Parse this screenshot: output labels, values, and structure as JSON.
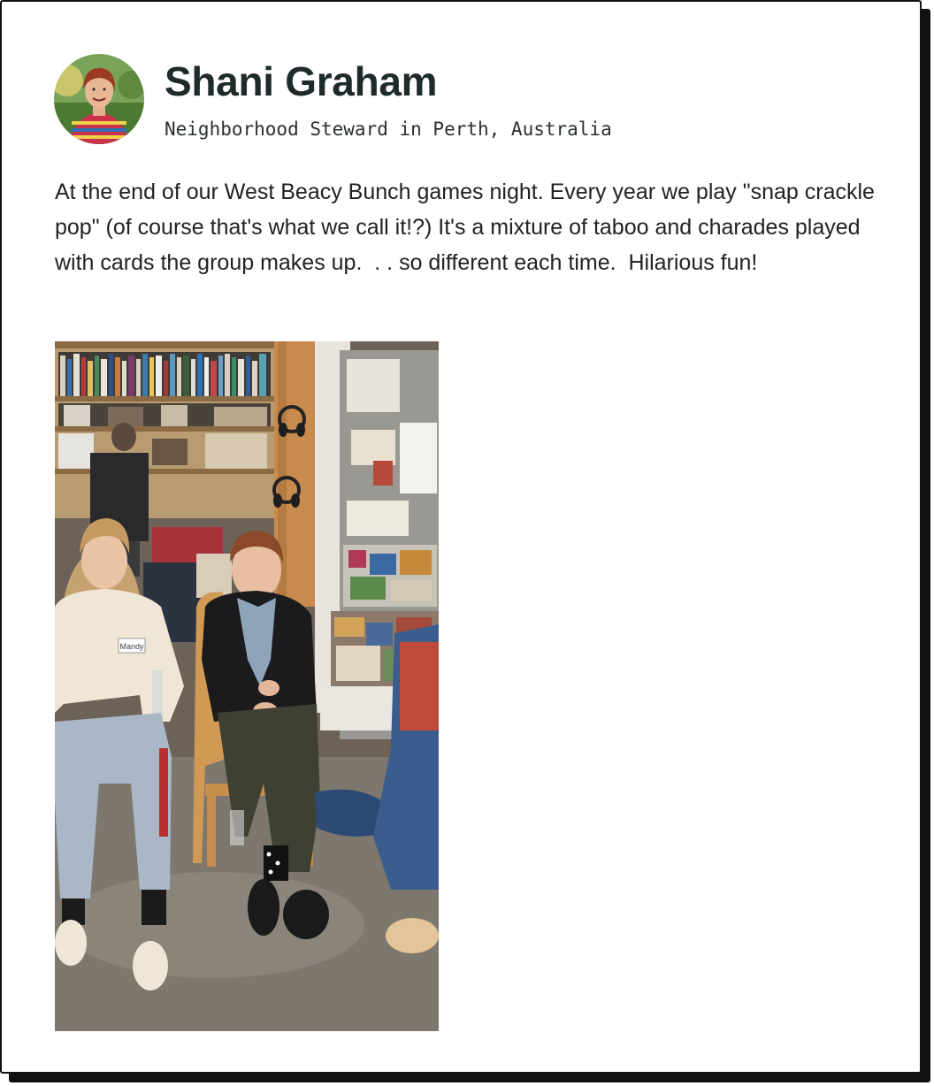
{
  "author": {
    "name": "Shani Graham",
    "role": "Neighborhood Steward in Perth, Australia"
  },
  "post": {
    "text": "At the end of our West Beacy Bunch games night. Every year we play \"snap crackle pop\" (of course that's what we call it!?) It's a mixture of taboo and charades played with cards the group makes up.  . . so different each time.  Hilarious fun!",
    "photo_name_tag": "Mandy"
  }
}
